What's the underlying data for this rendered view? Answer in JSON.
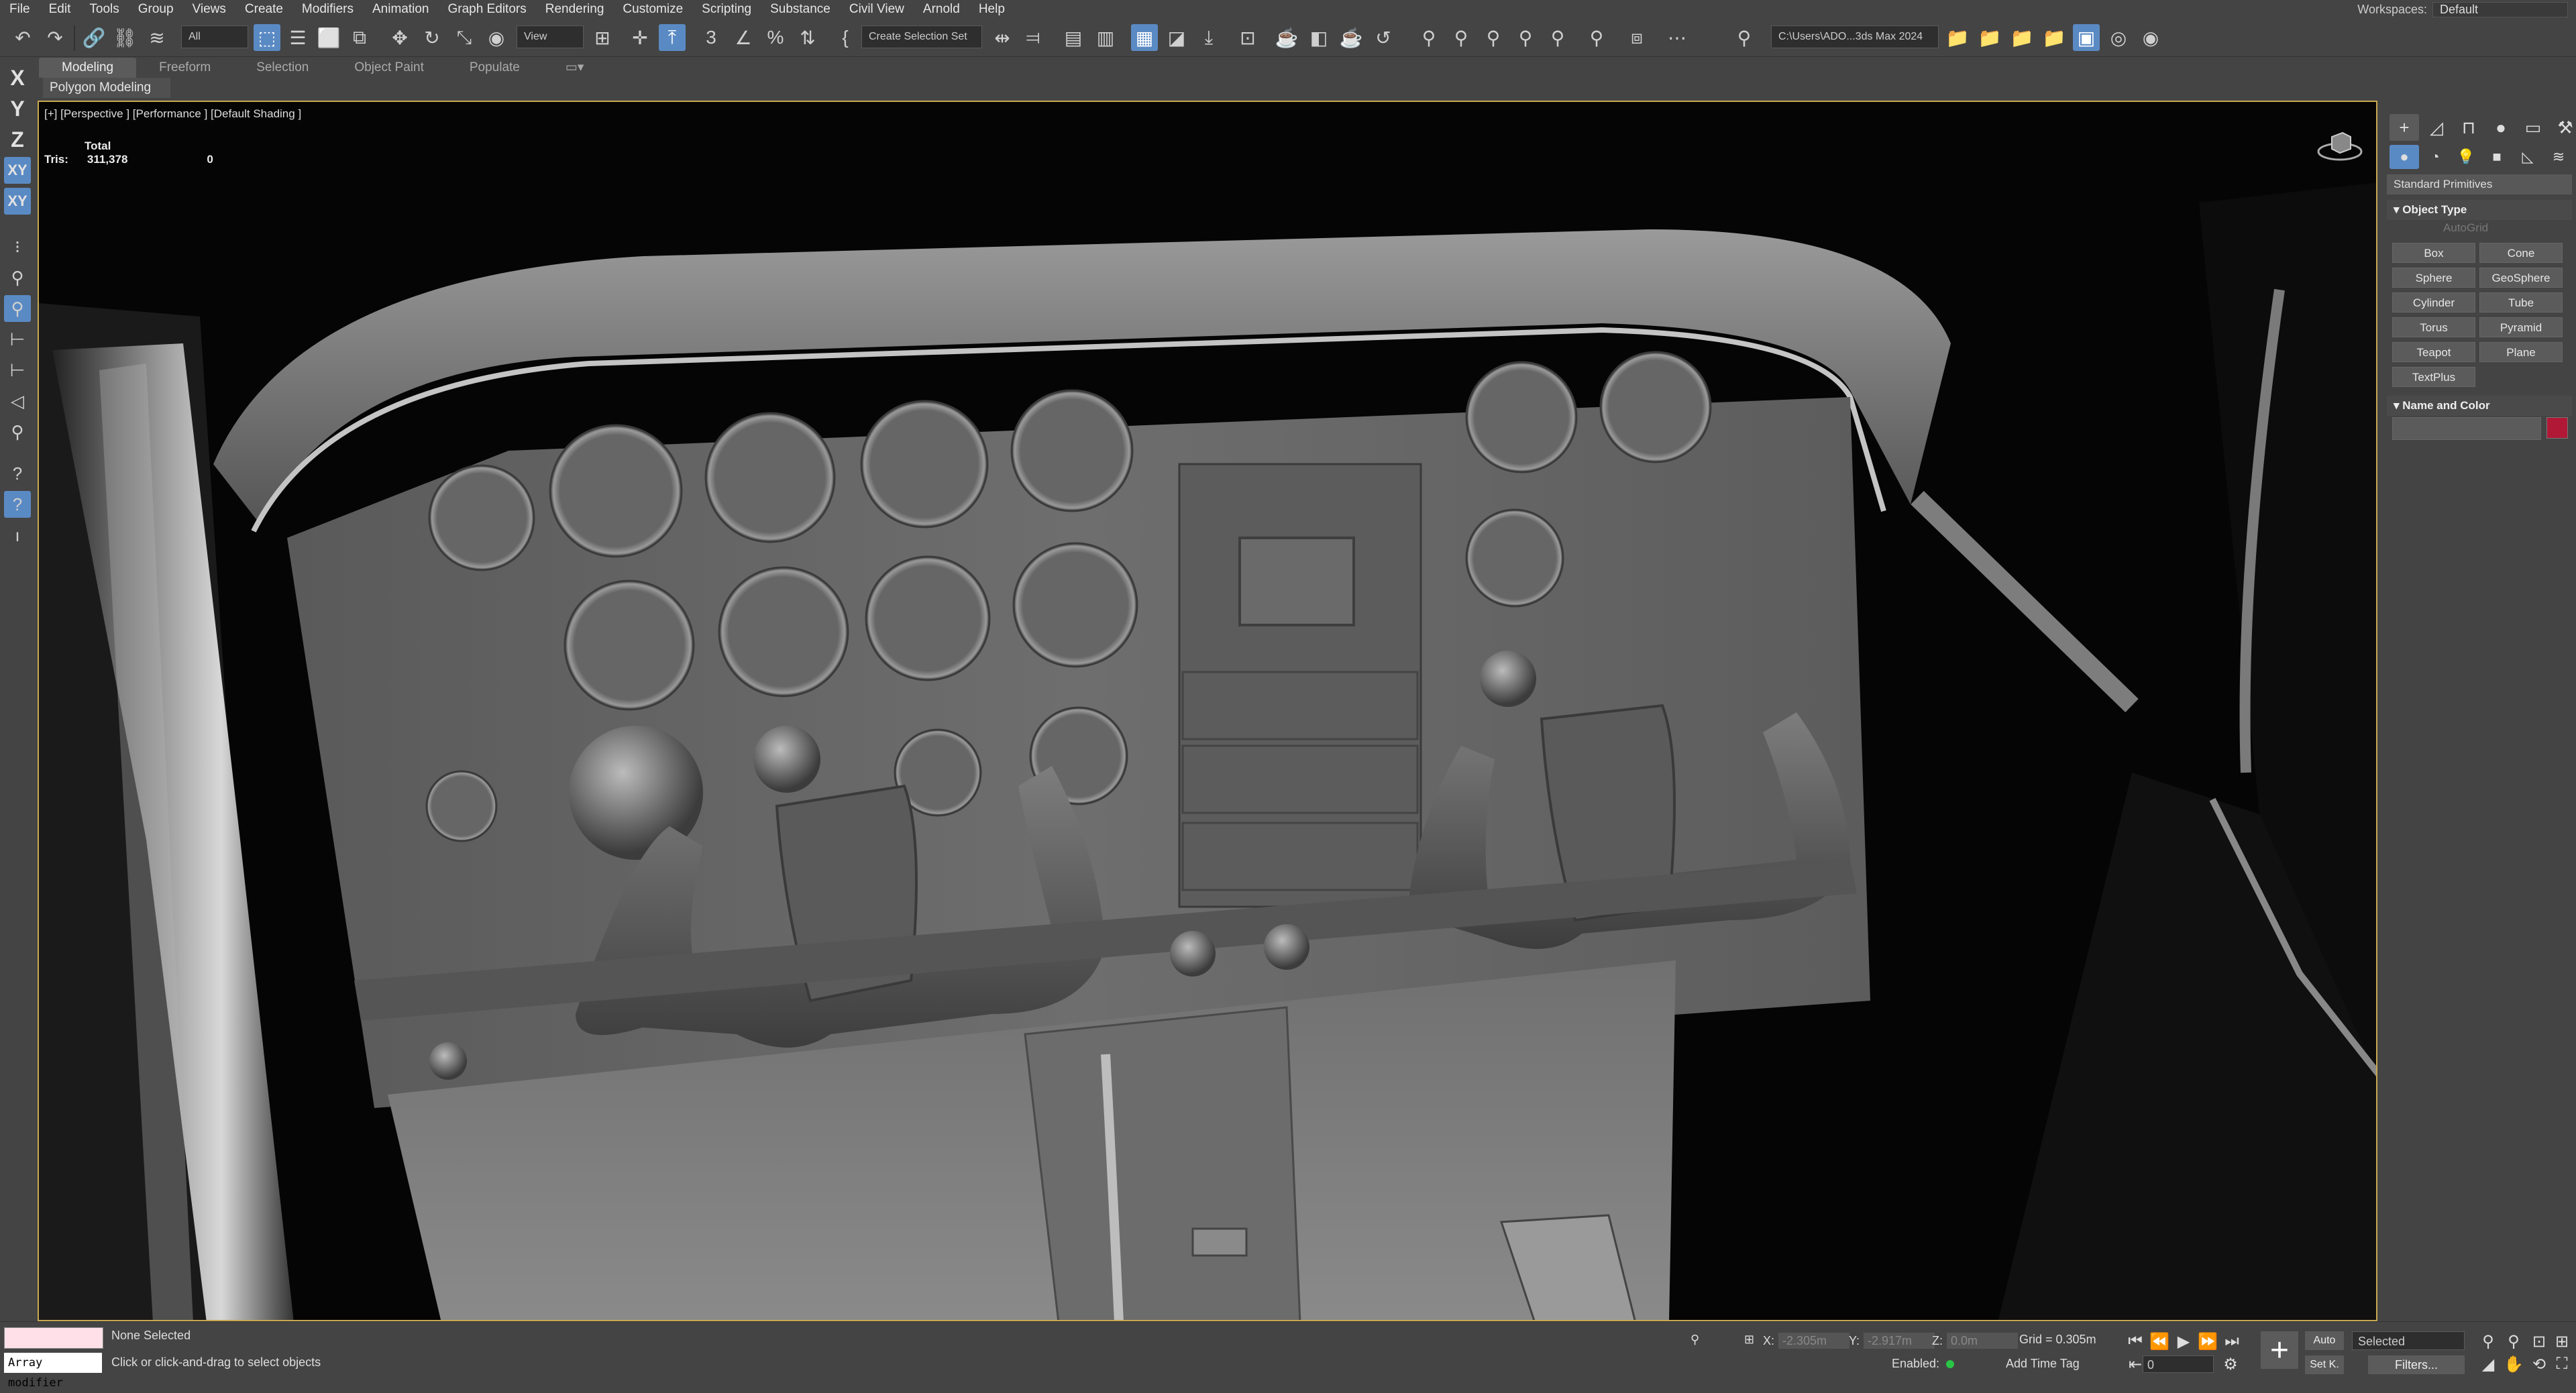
{
  "menu": [
    "File",
    "Edit",
    "Tools",
    "Group",
    "Views",
    "Create",
    "Modifiers",
    "Animation",
    "Graph Editors",
    "Rendering",
    "Customize",
    "Scripting",
    "Substance",
    "Civil View",
    "Arnold",
    "Help"
  ],
  "workspace": {
    "label": "Workspaces:",
    "value": "Default"
  },
  "toolbar": {
    "filter_select": "All",
    "ref_coord": "View",
    "named_selection": "Create Selection Set",
    "project_path": "C:\\Users\\ADO...3ds Max 2024"
  },
  "ribbon": {
    "tabs": [
      "Modeling",
      "Freeform",
      "Selection",
      "Object Paint",
      "Populate"
    ],
    "sub": "Polygon Modeling"
  },
  "axis_buttons": [
    "X",
    "Y",
    "Z",
    "XY",
    "XY"
  ],
  "viewport": {
    "label": "[+] [Perspective ] [Performance ] [Default Shading ]",
    "stats_header": "Total",
    "stats_label": "Tris:",
    "stats_total": "311,378",
    "stats_selected": "0"
  },
  "command_panel": {
    "category": "Standard Primitives",
    "object_type_title": "Object Type",
    "autogrid": "AutoGrid",
    "primitives": [
      "Box",
      "Cone",
      "Sphere",
      "GeoSphere",
      "Cylinder",
      "Tube",
      "Torus",
      "Pyramid",
      "Teapot",
      "Plane",
      "TextPlus"
    ],
    "name_color_title": "Name and Color",
    "color": "#b01836"
  },
  "status": {
    "maxscript_value": "Array modifier",
    "selection": "None Selected",
    "prompt": "Click or click-and-drag to select objects",
    "x_label": "X:",
    "x_value": "-2.305m",
    "y_label": "Y:",
    "y_value": "-2.917m",
    "z_label": "Z:",
    "z_value": "0.0m",
    "grid": "Grid = 0.305m",
    "enabled": "Enabled:",
    "time_tag": "Add Time Tag",
    "auto": "Auto",
    "setk": "Set K.",
    "selected": "Selected",
    "filters": "Filters...",
    "frame": "0"
  }
}
